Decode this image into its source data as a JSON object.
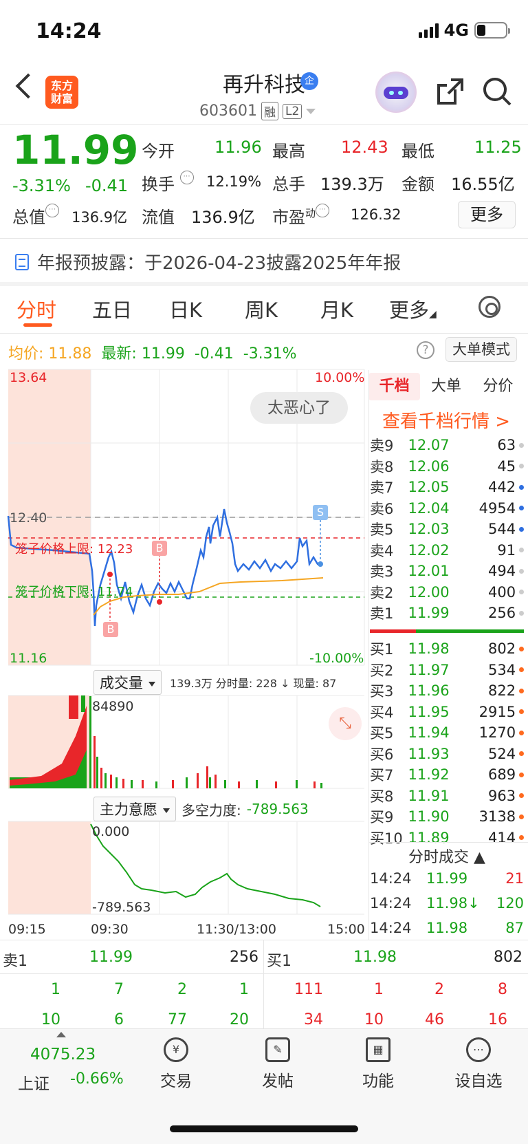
{
  "status": {
    "time": "14:24",
    "network": "4G"
  },
  "header": {
    "logo_text_1": "东方",
    "logo_text_2": "财富",
    "stock_name": "再升科技",
    "badge": "企",
    "code": "603601",
    "tag_rong": "融",
    "tag_l2": "L2"
  },
  "quote": {
    "price": "11.99",
    "change_pct": "-3.31%",
    "change": "-0.41",
    "open_label": "今开",
    "open": "11.96",
    "high_label": "最高",
    "high": "12.43",
    "low_label": "最低",
    "low": "11.25",
    "turnover_label": "换手",
    "turnover": "12.19%",
    "volume_label": "总手",
    "volume": "139.3万",
    "amount_label": "金额",
    "amount": "16.55亿",
    "mktcap_label": "总值",
    "mktcap": "136.9亿",
    "float_label": "流值",
    "float": "136.9亿",
    "pe_label": "市盈",
    "pe_sup": "动",
    "pe": "126.32",
    "more": "更多"
  },
  "notice": {
    "text": "年报预披露：于2026-04-23披露2025年年报"
  },
  "tabs": [
    "分时",
    "五日",
    "日K",
    "周K",
    "月K",
    "更多"
  ],
  "summary": {
    "avg_label": "均价:",
    "avg": "11.88",
    "latest_label": "最新:",
    "latest": "11.99",
    "change": "-0.41",
    "change_pct": "-3.31%",
    "help": "?",
    "bigmode": "大单模式"
  },
  "chart": {
    "y_top": "13.64",
    "y_bottom": "11.16",
    "pct_top": "10.00%",
    "pct_bottom": "-10.00%",
    "ref_price": "12.40",
    "upper_label": "笼子价格上限: 12.23",
    "lower_label": "笼子价格下限: 11.74",
    "marker_b": "B",
    "marker_s": "S",
    "toast": "太恶心了",
    "volume_dropdown": "成交量",
    "volume_info": "139.3万 分时量: 228 ↓ 现量: 87",
    "volume_max": "84890",
    "zhuli_dropdown": "主力意愿",
    "zhuli_info_label": "多空力度:",
    "zhuli_info_value": "-789.563",
    "zhuli_top": "0.000",
    "zhuli_bottom": "-789.563",
    "times": [
      "09:15",
      "09:30",
      "11:30/13:00",
      "15:00"
    ],
    "expand_icon": "expand-icon"
  },
  "orderbook": {
    "tabs": [
      "千档",
      "大单",
      "分价"
    ],
    "link": "查看千档行情 >",
    "asks": [
      {
        "label": "卖9",
        "price": "12.07",
        "vol": "63",
        "dot": "#cccccc"
      },
      {
        "label": "卖8",
        "price": "12.06",
        "vol": "45",
        "dot": "#cccccc"
      },
      {
        "label": "卖7",
        "price": "12.05",
        "vol": "442",
        "dot": "#2f6fe0"
      },
      {
        "label": "卖6",
        "price": "12.04",
        "vol": "4954",
        "dot": "#2f6fe0"
      },
      {
        "label": "卖5",
        "price": "12.03",
        "vol": "544",
        "dot": "#2f6fe0"
      },
      {
        "label": "卖4",
        "price": "12.02",
        "vol": "91",
        "dot": "#cccccc"
      },
      {
        "label": "卖3",
        "price": "12.01",
        "vol": "494",
        "dot": "#cccccc"
      },
      {
        "label": "卖2",
        "price": "12.00",
        "vol": "400",
        "dot": "#cccccc"
      },
      {
        "label": "卖1",
        "price": "11.99",
        "vol": "256",
        "dot": "#cccccc"
      }
    ],
    "bids": [
      {
        "label": "买1",
        "price": "11.98",
        "vol": "802",
        "dot": "#ff6a1f"
      },
      {
        "label": "买2",
        "price": "11.97",
        "vol": "534",
        "dot": "#ff6a1f"
      },
      {
        "label": "买3",
        "price": "11.96",
        "vol": "822",
        "dot": "#ff6a1f"
      },
      {
        "label": "买4",
        "price": "11.95",
        "vol": "2915",
        "dot": "#ff6a1f"
      },
      {
        "label": "买5",
        "price": "11.94",
        "vol": "1270",
        "dot": "#ff6a1f"
      },
      {
        "label": "买6",
        "price": "11.93",
        "vol": "524",
        "dot": "#ff6a1f"
      },
      {
        "label": "买7",
        "price": "11.92",
        "vol": "689",
        "dot": "#ff6a1f"
      },
      {
        "label": "买8",
        "price": "11.91",
        "vol": "963",
        "dot": "#ff6a1f"
      },
      {
        "label": "买9",
        "price": "11.90",
        "vol": "3138",
        "dot": "#ff6a1f"
      },
      {
        "label": "买10",
        "price": "11.89",
        "vol": "414",
        "dot": "#ff6a1f"
      }
    ],
    "ticks_head": "分时成交",
    "ticks": [
      {
        "time": "14:24",
        "price": "11.99",
        "vol": "21",
        "color": "#e8262a"
      },
      {
        "time": "14:24",
        "price": "11.98↓",
        "vol": "120",
        "color": "#1aa31a"
      },
      {
        "time": "14:24",
        "price": "11.98",
        "vol": "87",
        "color": "#1aa31a"
      }
    ]
  },
  "queue": {
    "sell_label": "卖1",
    "sell_price": "11.99",
    "sell_vol": "256",
    "buy_label": "买1",
    "buy_price": "11.98",
    "buy_vol": "802",
    "sell_row1": [
      "1",
      "7",
      "2",
      "1"
    ],
    "sell_row2": [
      "10",
      "6",
      "77",
      "20"
    ],
    "buy_row1": [
      "111",
      "1",
      "2",
      "8"
    ],
    "buy_row2": [
      "34",
      "10",
      "46",
      "16"
    ]
  },
  "bottom": {
    "index_value": "4075.23",
    "index_name": "上证",
    "index_change": "-0.66%",
    "nav": [
      "交易",
      "发帖",
      "功能",
      "设自选"
    ]
  },
  "colors": {
    "up": "#e8262a",
    "down": "#1aa31a",
    "accent": "#ff5a1f",
    "price_line": "#2f6fe0",
    "avg_line": "#f5a623"
  }
}
